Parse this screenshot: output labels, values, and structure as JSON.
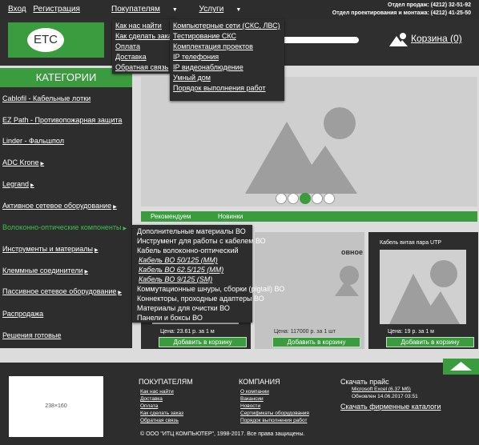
{
  "topbar": {
    "login": "Вход",
    "register": "Регистрация",
    "nav_customers": "Покупателям",
    "nav_services": "Услуги",
    "phone_sales": "Отдел продаж: (4212) 32-51-92",
    "phone_design": "Отдел проектирования и монтажа: (4212) 41-25-50"
  },
  "header": {
    "logo_text": "ETC",
    "cart_label": "Корзина (0)"
  },
  "customers_menu": [
    "Как нас найти",
    "Как сделать заказ",
    "Оплата",
    "Доставка",
    "Обратная связь"
  ],
  "services_menu": [
    "Компьютерные сети (СКС, ЛВС)",
    "Тестирование СКС",
    "Комплектация проектов",
    "IP телефония",
    "IP видеонаблюдение",
    "Умный дом",
    "Порядок выполнения работ"
  ],
  "sidebar": {
    "title": "КАТЕГОРИИ",
    "items": [
      "Cablofil - Кабельные лотки",
      "EZ Path - Противопожарная защита",
      " Linder - Фальшпол ",
      "ADC Krone",
      "Legrand",
      "Активное сетевое оборудование",
      "Волоконно-оптические компоненты",
      "Инструменты и материалы",
      "Клеммные соединители",
      "Пассивное сетевое оборудование",
      "Распродажа",
      "Решения готовые"
    ]
  },
  "fiber_menu": [
    "Дополнительные материалы ВО",
    "Инструмент для работы с кабелем ВО",
    "Кабель волоконно-оптический",
    "Кабель ВО 50/125 (MM)",
    "Кабель ВО 62.5/125 (MM)",
    "Кабель ВО 9/125 (SM)",
    "Коммутационные шнуры, сборки (pigtail) ВО",
    "Коннекторы, проходные адаптеры ВО",
    "Материалы для очистки ВО",
    "Панели и боксы ВО"
  ],
  "tabs": [
    "Рекомендуем",
    "Новинки"
  ],
  "products": [
    {
      "name": "",
      "price": "Цена: 23.61 р. за 1 м",
      "button": "Добавить в корзину"
    },
    {
      "name": "овное",
      "price": "Цена: 117000 р. за 1 шт",
      "button": "Добавить в корзину"
    },
    {
      "name": "Кабель витая пара UTP",
      "price": "Цена: 19 р. за 1 м",
      "button": "Добавить в корзину"
    }
  ],
  "footer": {
    "banner_size": "238×160",
    "customers_title": "ПОКУПАТЕЛЯМ",
    "customers_links": [
      "Как нас найти",
      "Доставка",
      "Оплата",
      "Как сделать заказ",
      "Обратная связь"
    ],
    "company_title": "КОМПАНИЯ",
    "company_links": [
      "О компании",
      "Вакансии",
      "Новости",
      "Сертификаты оборудования",
      "Порядок выполнения работ"
    ],
    "price_title": "Скачать прайс",
    "price_file": "Microsoft Excel (6.37 Мб)",
    "price_updated": "Обновлен 14.06.2017 03:51",
    "catalogs": "Скачать фирменные каталоги",
    "copyright": "© ООО \"ИТЦ КОМПЬЮТЕР\", 1998-2017. Все права защищены."
  },
  "colors": {
    "accent": "#3a9b3f",
    "dark": "#2d2d2d",
    "active_text": "#3fc14c"
  },
  "slider_active_dot": 3
}
